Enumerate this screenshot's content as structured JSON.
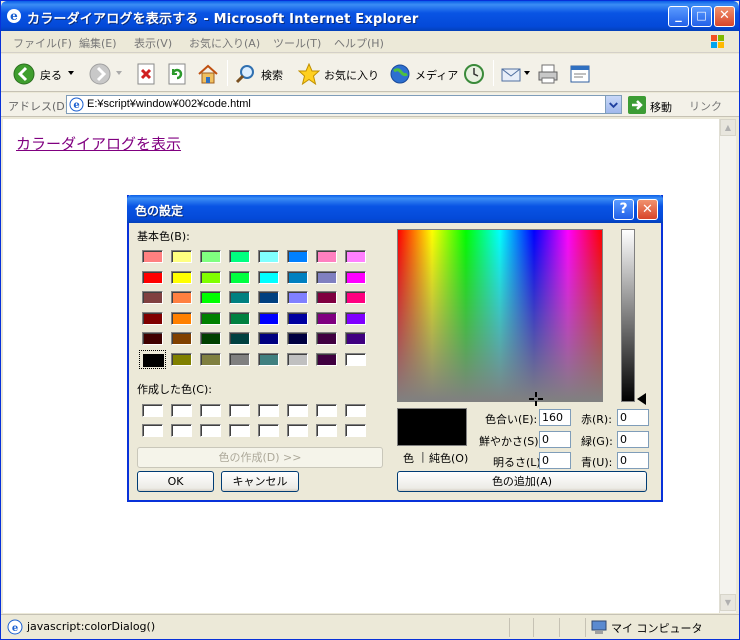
{
  "window": {
    "title": "カラーダイアログを表示する - Microsoft Internet Explorer",
    "minimize": "_",
    "maximize": "□",
    "close": "✕"
  },
  "menu": [
    "ファイル(F)",
    "編集(E)",
    "表示(V)",
    "お気に入り(A)",
    "ツール(T)",
    "ヘルプ(H)"
  ],
  "toolbar": {
    "back": "戻る",
    "search": "検索",
    "favorites": "お気に入り",
    "media": "メディア"
  },
  "address": {
    "label": "アドレス(D)",
    "url": "E:¥script¥window¥002¥code.html",
    "go": "移動",
    "links": "リンク"
  },
  "page": {
    "link_text": "カラーダイアログを表示"
  },
  "status": {
    "text": "javascript:colorDialog()",
    "zone": "マイ コンピュータ"
  },
  "dialog": {
    "title": "色の設定",
    "help": "?",
    "close": "✕",
    "basic_label": "基本色(B):",
    "custom_label": "作成した色(C):",
    "define_button": "色の作成(D) >>",
    "ok_button": "OK",
    "cancel_button": "キャンセル",
    "add_button": "色の追加(A)",
    "preview_label": "色",
    "solid_label": "純色(O)",
    "hue_label": "色合い(E):",
    "sat_label": "鮮やかさ(S):",
    "lum_label": "明るさ(L):",
    "red_label": "赤(R):",
    "green_label": "緑(G):",
    "blue_label": "青(U):",
    "hue": "160",
    "sat": "0",
    "lum": "0",
    "red": "0",
    "green": "0",
    "blue": "0",
    "selected_color": "#000000",
    "basic_colors": [
      "#ff8080",
      "#ffff80",
      "#80ff80",
      "#00ff80",
      "#80ffff",
      "#0080ff",
      "#ff80c0",
      "#ff80ff",
      "#ff0000",
      "#ffff00",
      "#80ff00",
      "#00ff40",
      "#00ffff",
      "#0080c0",
      "#8080c0",
      "#ff00ff",
      "#804040",
      "#ff8040",
      "#00ff00",
      "#008080",
      "#004080",
      "#8080ff",
      "#800040",
      "#ff0080",
      "#800000",
      "#ff8000",
      "#008000",
      "#008040",
      "#0000ff",
      "#0000a0",
      "#800080",
      "#8000ff",
      "#400000",
      "#804000",
      "#004000",
      "#004040",
      "#000080",
      "#000040",
      "#400040",
      "#400080",
      "#000000",
      "#808000",
      "#808040",
      "#808080",
      "#408080",
      "#c0c0c0",
      "#400040",
      "#ffffff"
    ],
    "selected_index": 40,
    "custom_colors": [
      "#ffffff",
      "#ffffff",
      "#ffffff",
      "#ffffff",
      "#ffffff",
      "#ffffff",
      "#ffffff",
      "#ffffff",
      "#ffffff",
      "#ffffff",
      "#ffffff",
      "#ffffff",
      "#ffffff",
      "#ffffff",
      "#ffffff",
      "#ffffff"
    ]
  }
}
